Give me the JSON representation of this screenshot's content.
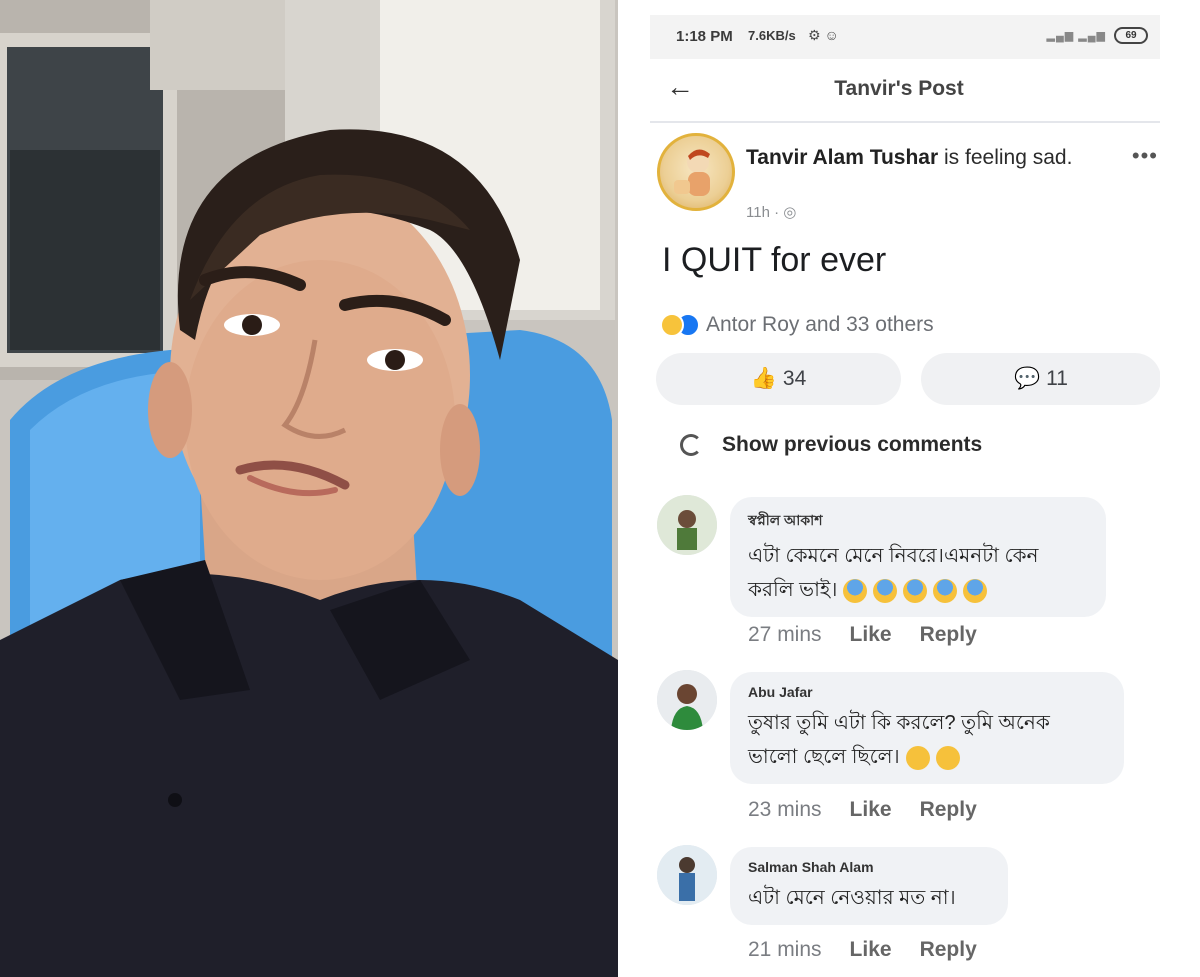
{
  "status_bar": {
    "time": "1:18 PM",
    "speed": "7.6KB/s",
    "icons": "⚙ ☺",
    "signal": "▂▄▆ ▂▄▆",
    "battery": "69"
  },
  "header": {
    "back_icon": "←",
    "title": "Tanvir's Post"
  },
  "post": {
    "author": "Tanvir Alam Tushar",
    "feeling": " is feeling sad.",
    "time": "11h · ◎",
    "more_icon": "•••",
    "text": "I QUIT for ever",
    "reactions_text": "Antor Roy and 33 others",
    "likes": "34",
    "comments": "11",
    "like_icon": "👍",
    "comment_icon": "💬"
  },
  "show_previous": "Show previous comments",
  "comments": [
    {
      "name": "স্বপ্নীল আকাশ",
      "line1": "এটা কেমনে মেনে নিবরে।এমনটা কেন",
      "line2": "করলি ভাই।",
      "time": "27 mins",
      "like": "Like",
      "reply": "Reply"
    },
    {
      "name": "Abu Jafar",
      "line1": "তুষার তুমি এটা কি করলে?  তুমি অনেক",
      "line2": "ভালো ছেলে ছিলে।",
      "time": "23 mins",
      "like": "Like",
      "reply": "Reply"
    },
    {
      "name": "Salman Shah Alam",
      "line1": "এটা মেনে নেওয়ার মত না।",
      "time": "21 mins",
      "like": "Like",
      "reply": "Reply"
    }
  ],
  "colors": {
    "like_blue": "#1877f2",
    "bubble_bg": "#f0f2f5",
    "pill_bg": "#f0f1f3",
    "seat_blue": "#4a9ce0",
    "shirt": "#1f1f2a"
  }
}
